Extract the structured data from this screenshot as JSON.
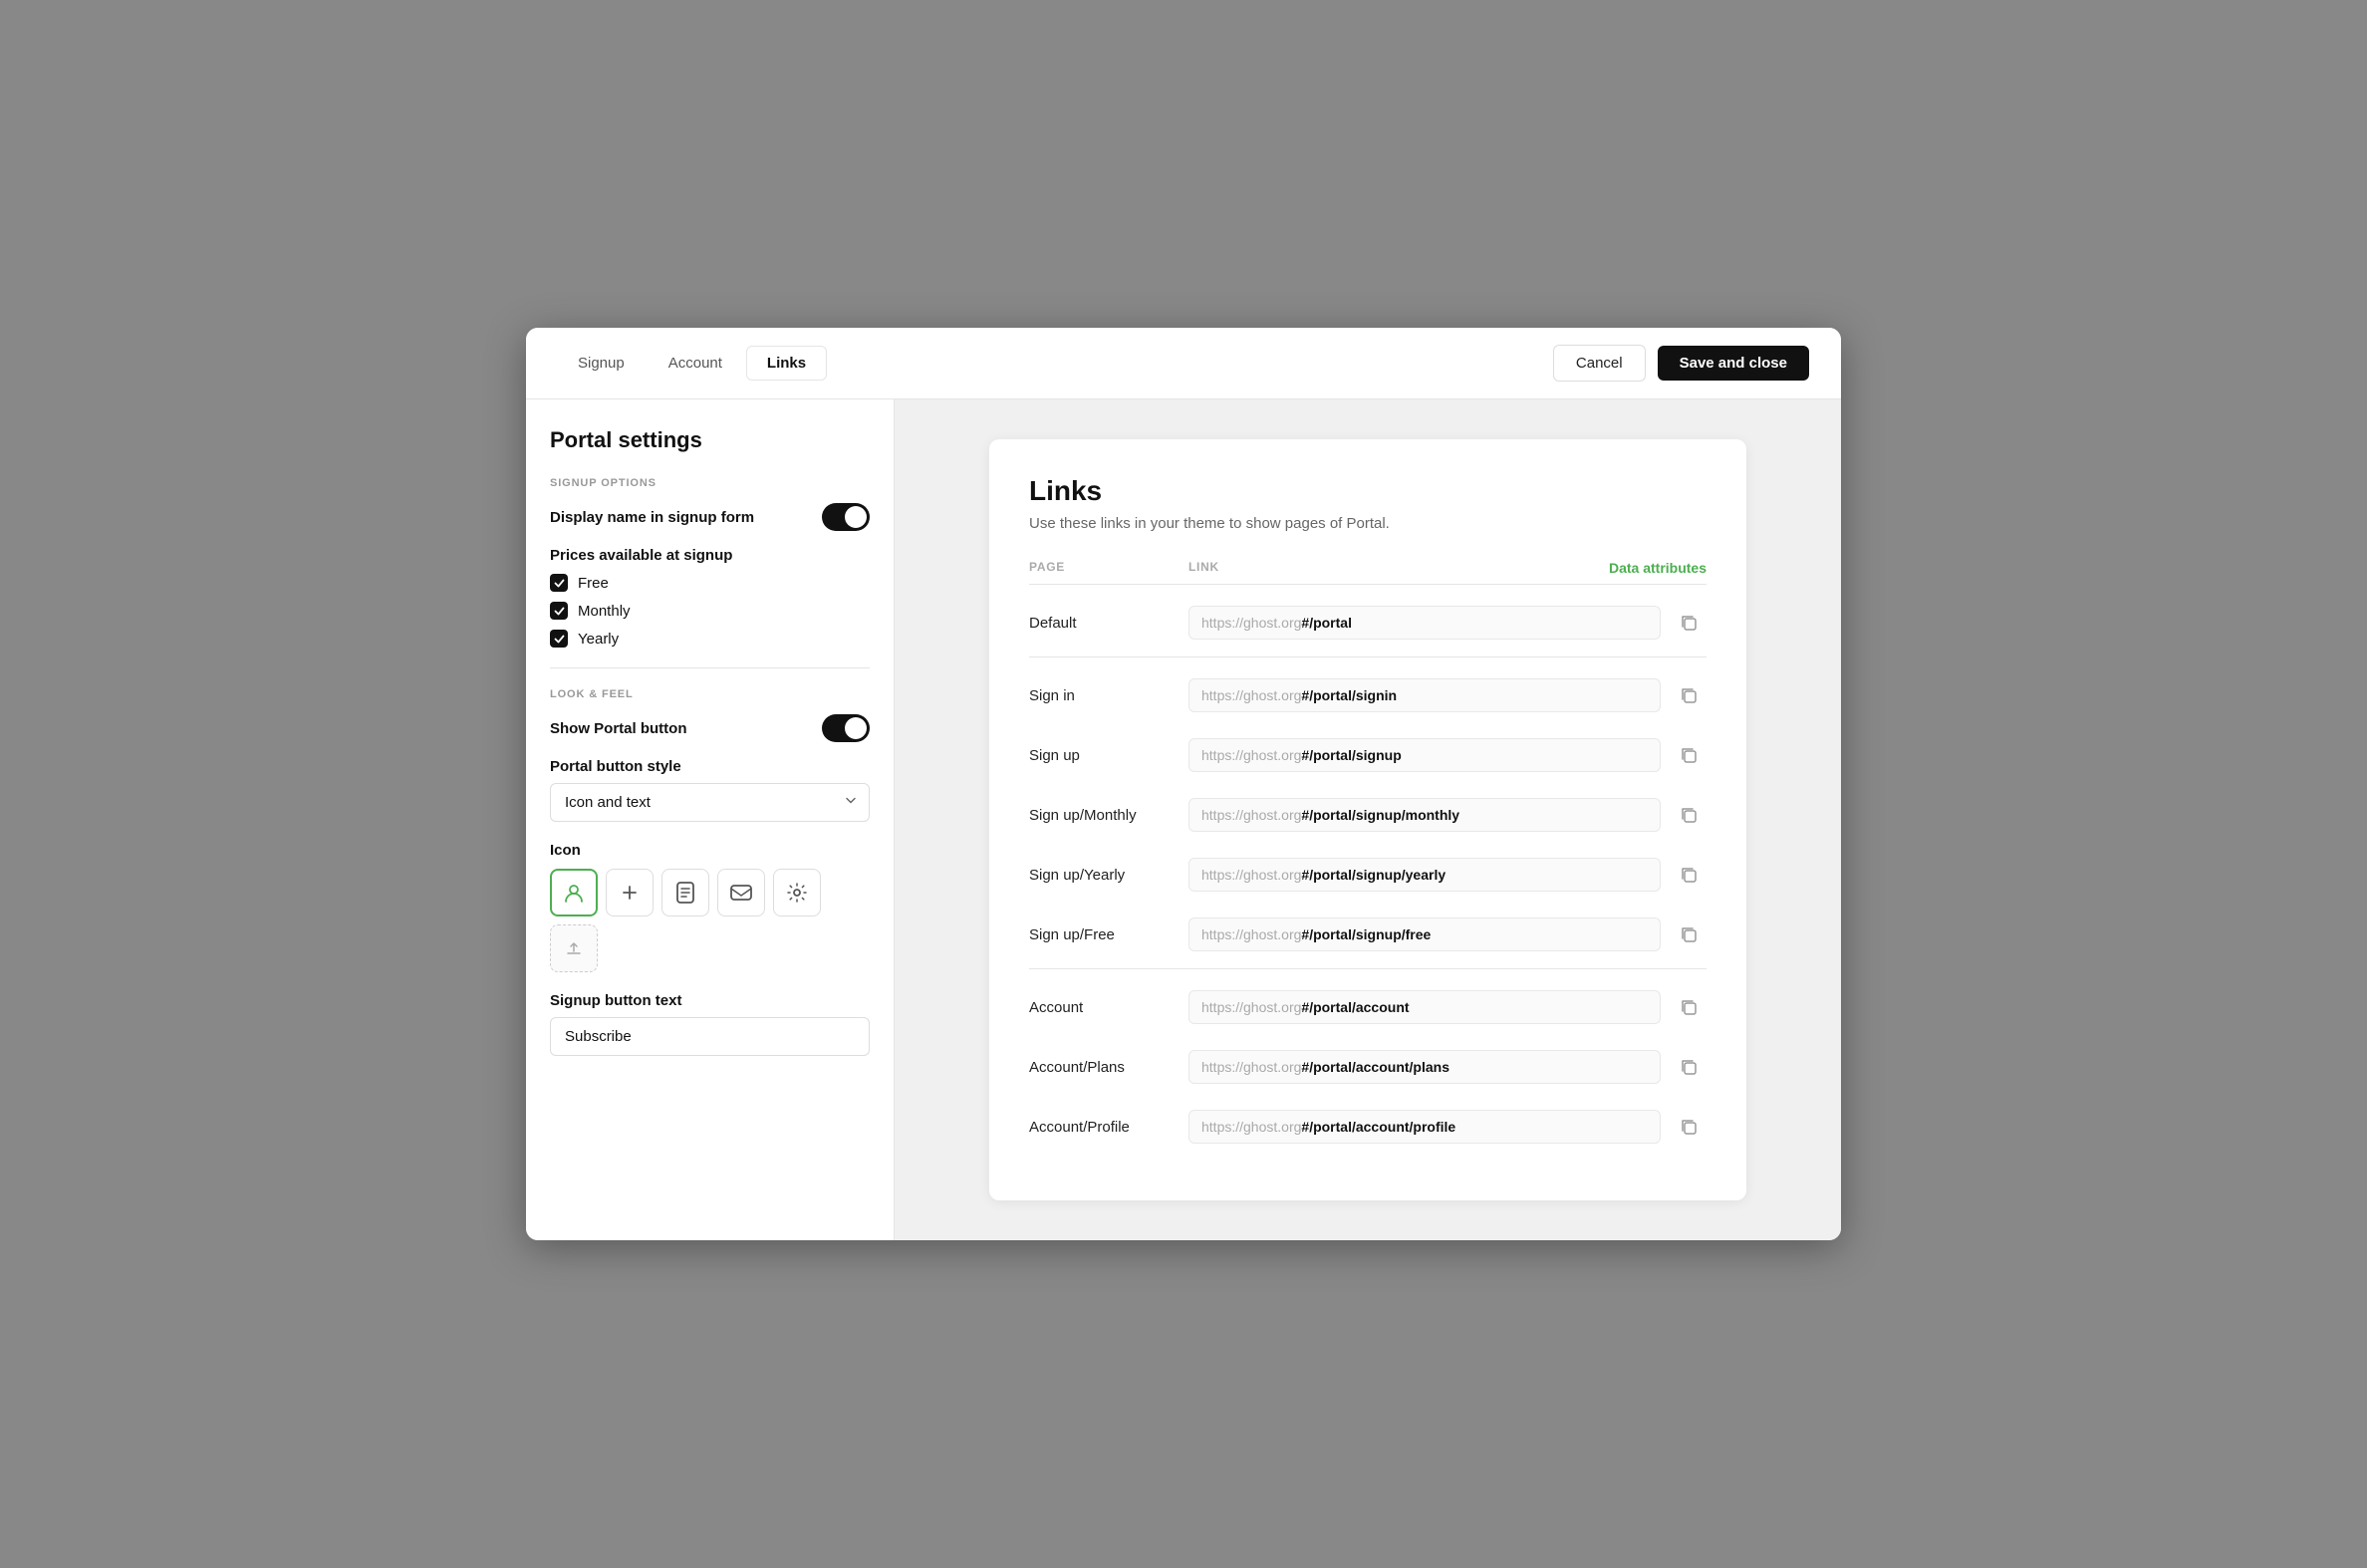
{
  "sidebar": {
    "title": "Portal settings",
    "signup_options_label": "Signup Options",
    "display_name_label": "Display name in signup form",
    "prices_label": "Prices available at signup",
    "prices": [
      {
        "id": "free",
        "label": "Free",
        "checked": true
      },
      {
        "id": "monthly",
        "label": "Monthly",
        "checked": true
      },
      {
        "id": "yearly",
        "label": "Yearly",
        "checked": true
      }
    ],
    "look_feel_label": "Look & Feel",
    "show_portal_label": "Show Portal button",
    "button_style_label": "Portal button style",
    "button_style_value": "Icon and text",
    "icon_label": "Icon",
    "signup_text_label": "Signup button text",
    "signup_text_value": "Subscribe"
  },
  "tabs": [
    {
      "id": "signup",
      "label": "Signup",
      "active": false
    },
    {
      "id": "account",
      "label": "Account",
      "active": false
    },
    {
      "id": "links",
      "label": "Links",
      "active": true
    }
  ],
  "header": {
    "cancel_label": "Cancel",
    "save_label": "Save and close"
  },
  "links": {
    "title": "Links",
    "subtitle": "Use these links in your theme to show pages of Portal.",
    "col_page": "Page",
    "col_link": "Link",
    "col_data": "Data attributes",
    "sections": [
      {
        "rows": [
          {
            "page": "Default",
            "url_prefix": "https://ghost.org",
            "url_bold": "#/portal"
          }
        ]
      },
      {
        "rows": [
          {
            "page": "Sign in",
            "url_prefix": "https://ghost.org",
            "url_bold": "#/portal/signin"
          },
          {
            "page": "Sign up",
            "url_prefix": "https://ghost.org",
            "url_bold": "#/portal/signup"
          },
          {
            "page": "Sign up/Monthly",
            "url_prefix": "https://ghost.org",
            "url_bold": "#/portal/signup/monthly"
          },
          {
            "page": "Sign up/Yearly",
            "url_prefix": "https://ghost.org",
            "url_bold": "#/portal/signup/yearly"
          },
          {
            "page": "Sign up/Free",
            "url_prefix": "https://ghost.org",
            "url_bold": "#/portal/signup/free"
          }
        ]
      },
      {
        "rows": [
          {
            "page": "Account",
            "url_prefix": "https://ghost.org",
            "url_bold": "#/portal/account"
          },
          {
            "page": "Account/Plans",
            "url_prefix": "https://ghost.org",
            "url_bold": "#/portal/account/plans"
          },
          {
            "page": "Account/Profile",
            "url_prefix": "https://ghost.org",
            "url_bold": "#/portal/account/profile"
          }
        ]
      }
    ]
  }
}
